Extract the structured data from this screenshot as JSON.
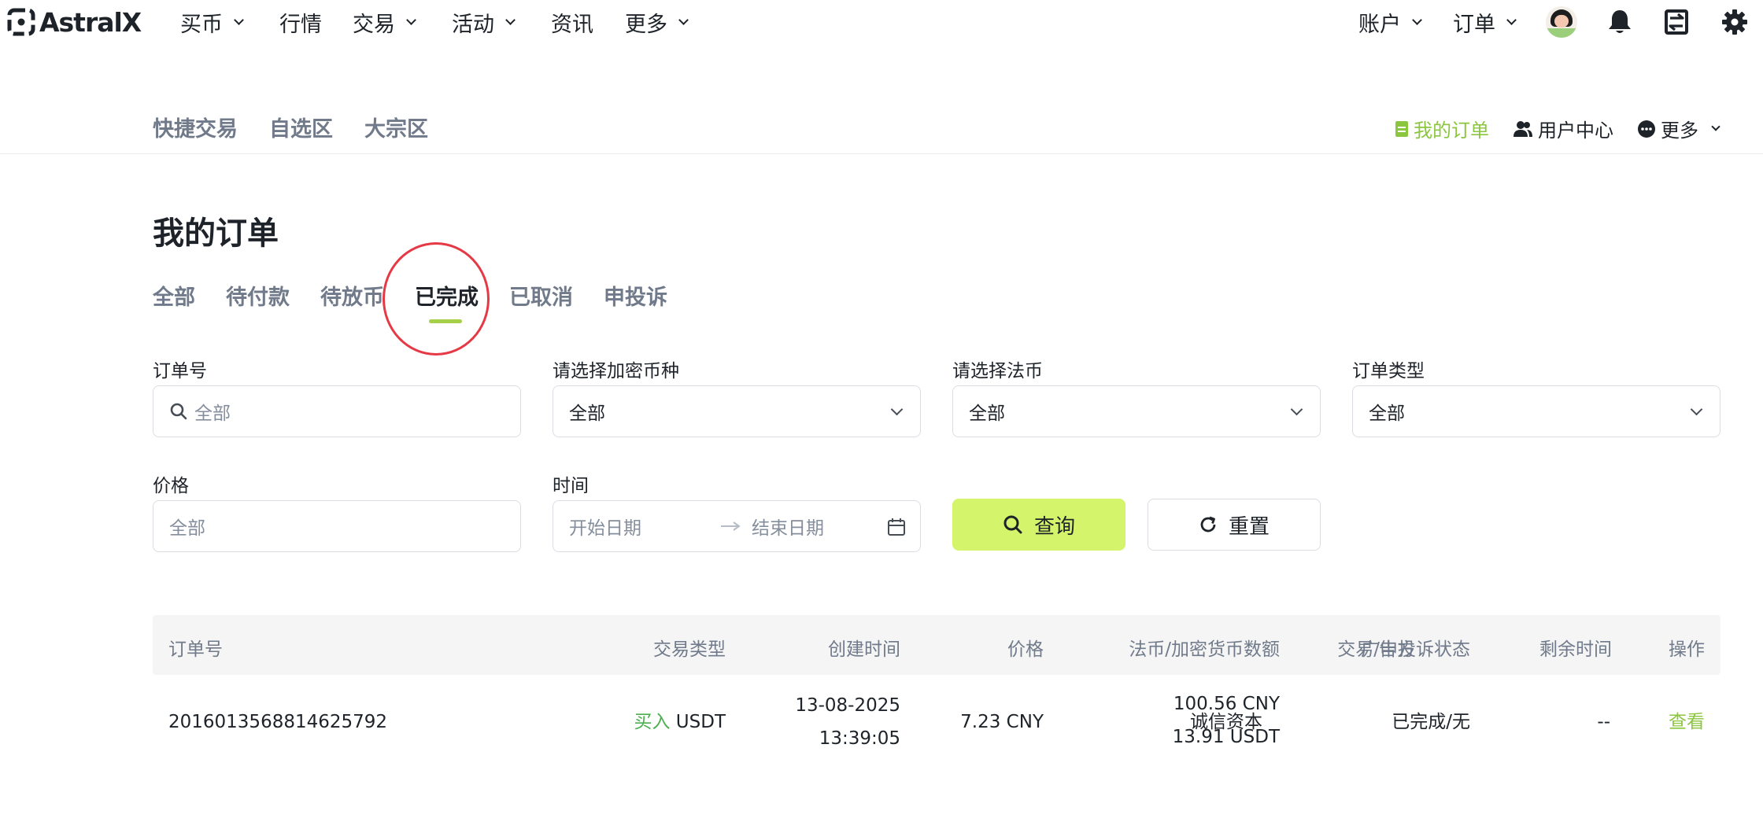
{
  "brand": {
    "name": "AstralX"
  },
  "topnav": {
    "items": [
      {
        "label": "买币",
        "dropdown": true
      },
      {
        "label": "行情",
        "dropdown": false
      },
      {
        "label": "交易",
        "dropdown": true
      },
      {
        "label": "活动",
        "dropdown": true
      },
      {
        "label": "资讯",
        "dropdown": false
      },
      {
        "label": "更多",
        "dropdown": true
      }
    ],
    "right_items": [
      {
        "label": "账户",
        "dropdown": true
      },
      {
        "label": "订单",
        "dropdown": true
      }
    ],
    "icons": [
      "avatar",
      "bell-icon",
      "deposit-icon",
      "gear-icon"
    ]
  },
  "subnav": {
    "left": [
      "快捷交易",
      "自选区",
      "大宗区"
    ],
    "right": {
      "my_orders": "我的订单",
      "user_center": "用户中心",
      "more": "更多"
    }
  },
  "page": {
    "title": "我的订单",
    "tabs": [
      "全部",
      "待付款",
      "待放币",
      "已完成",
      "已取消",
      "申投诉"
    ],
    "active_tab": "已完成"
  },
  "filters": {
    "order_no": {
      "label": "订单号",
      "placeholder": "全部"
    },
    "crypto": {
      "label": "请选择加密币种",
      "value": "全部"
    },
    "fiat": {
      "label": "请选择法币",
      "value": "全部"
    },
    "order_type": {
      "label": "订单类型",
      "value": "全部"
    },
    "price": {
      "label": "价格",
      "placeholder": "全部"
    },
    "time": {
      "label": "时间",
      "start_placeholder": "开始日期",
      "end_placeholder": "结束日期"
    },
    "query_button": "查询",
    "reset_button": "重置"
  },
  "table": {
    "columns": [
      "订单号",
      "交易类型",
      "创建时间",
      "价格",
      "法币/加密货币数额",
      "广告方",
      "交易/申投诉状态",
      "剩余时间",
      "操作"
    ],
    "rows": [
      {
        "order_no": "2016013568814625792",
        "side": "买入",
        "asset": "USDT",
        "created_date": "13-08-2025",
        "created_time": "13:39:05",
        "price": "7.23 CNY",
        "fiat_amount": "100.56 CNY",
        "crypto_amount": "13.91 USDT",
        "advertiser": "诚信资本",
        "status": "已完成/无",
        "remaining": "--",
        "action": "查看"
      }
    ]
  },
  "colors": {
    "accent_green": "#8cc63f",
    "primary_button": "#d4f56b",
    "buy_green": "#4caf50",
    "annotation_red": "#e63946"
  }
}
